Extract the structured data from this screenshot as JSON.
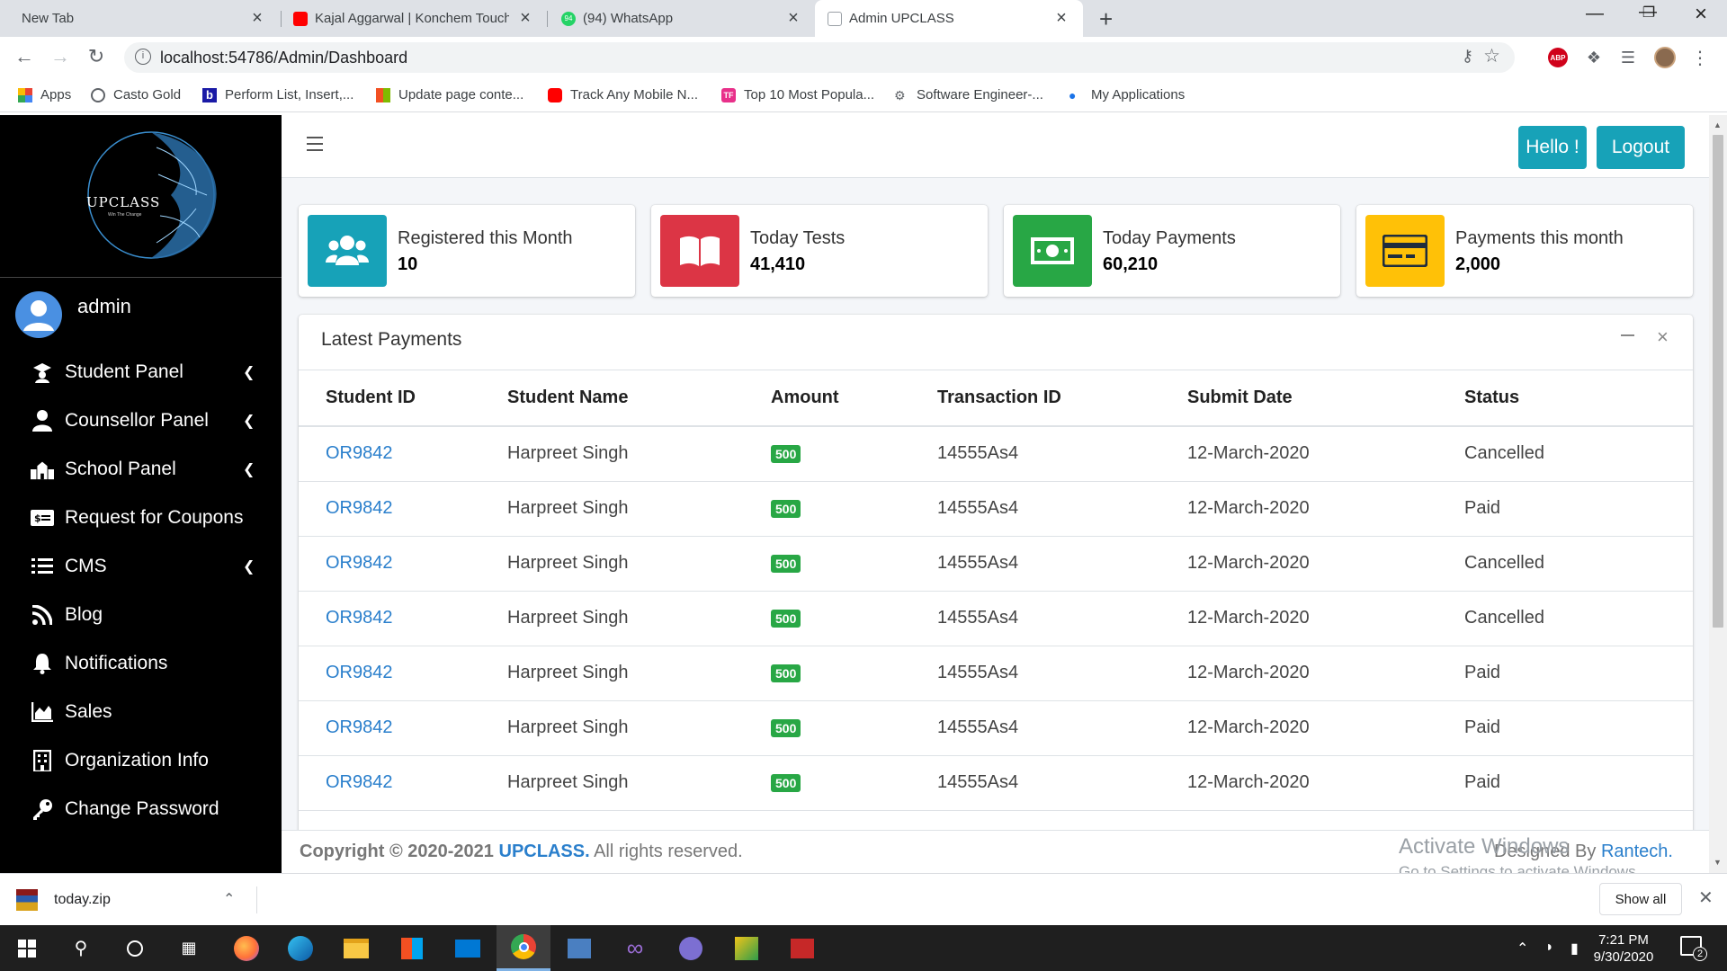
{
  "browser": {
    "tabs": [
      {
        "title": "New Tab",
        "active": false
      },
      {
        "title": "Kajal Aggarwal | Konchem Touch",
        "active": false
      },
      {
        "title": "(94) WhatsApp",
        "active": false
      },
      {
        "title": "Admin UPCLASS",
        "active": true
      }
    ],
    "url": "localhost:54786/Admin/Dashboard",
    "whatsapp_badge": "94",
    "abp_label": "ABP"
  },
  "bookmarks": [
    {
      "label": "Apps",
      "icon": "apps-grid-icon"
    },
    {
      "label": "Casto Gold",
      "icon": "globe-icon"
    },
    {
      "label": "Perform List, Insert,...",
      "icon": "b-logo-icon"
    },
    {
      "label": "Update page conte...",
      "icon": "microsoft-icon"
    },
    {
      "label": "Track Any Mobile N...",
      "icon": "youtube-icon"
    },
    {
      "label": "Top 10 Most Popula...",
      "icon": "tf-icon"
    },
    {
      "label": "Software Engineer-...",
      "icon": "bike-icon"
    },
    {
      "label": "My Applications",
      "icon": "bulb-icon"
    }
  ],
  "sidebar": {
    "logo_text": "UPCLASS",
    "logo_tagline": "Win The Change",
    "user_name": "admin",
    "items": [
      {
        "label": "Student Panel",
        "icon": "graduate-icon",
        "has_arrow": true
      },
      {
        "label": "Counsellor Panel",
        "icon": "user-icon",
        "has_arrow": true
      },
      {
        "label": "School Panel",
        "icon": "school-icon",
        "has_arrow": true
      },
      {
        "label": "Request for Coupons",
        "icon": "coupon-icon",
        "has_arrow": false
      },
      {
        "label": "CMS",
        "icon": "list-icon",
        "has_arrow": true
      },
      {
        "label": "Blog",
        "icon": "rss-icon",
        "has_arrow": false
      },
      {
        "label": "Notifications",
        "icon": "bell-icon",
        "has_arrow": false
      },
      {
        "label": "Sales",
        "icon": "chart-area-icon",
        "has_arrow": false
      },
      {
        "label": "Organization Info",
        "icon": "building-icon",
        "has_arrow": false
      },
      {
        "label": "Change Password",
        "icon": "key-icon",
        "has_arrow": false
      }
    ],
    "arrow_glyph": "❮"
  },
  "header": {
    "hello_label": "Hello !",
    "logout_label": "Logout"
  },
  "stats": [
    {
      "label": "Registered this Month",
      "value": "10",
      "color": "#17a2b8",
      "icon": "users-icon"
    },
    {
      "label": "Today Tests",
      "value": "41,410",
      "color": "#dc3545",
      "icon": "book-icon"
    },
    {
      "label": "Today Payments",
      "value": "60,210",
      "color": "#28a745",
      "icon": "money-icon"
    },
    {
      "label": "Payments this month",
      "value": "2,000",
      "color": "#ffc107",
      "icon": "credit-card-icon"
    }
  ],
  "payments": {
    "title": "Latest Payments",
    "close_glyph": "×",
    "columns": [
      "Student ID",
      "Student Name",
      "Amount",
      "Transaction ID",
      "Submit Date",
      "Status"
    ],
    "rows": [
      [
        "OR9842",
        "Harpreet Singh",
        "500",
        "14555As4",
        "12-March-2020",
        "Cancelled"
      ],
      [
        "OR9842",
        "Harpreet Singh",
        "500",
        "14555As4",
        "12-March-2020",
        "Paid"
      ],
      [
        "OR9842",
        "Harpreet Singh",
        "500",
        "14555As4",
        "12-March-2020",
        "Cancelled"
      ],
      [
        "OR9842",
        "Harpreet Singh",
        "500",
        "14555As4",
        "12-March-2020",
        "Cancelled"
      ],
      [
        "OR9842",
        "Harpreet Singh",
        "500",
        "14555As4",
        "12-March-2020",
        "Paid"
      ],
      [
        "OR9842",
        "Harpreet Singh",
        "500",
        "14555As4",
        "12-March-2020",
        "Paid"
      ],
      [
        "OR9842",
        "Harpreet Singh",
        "500",
        "14555As4",
        "12-March-2020",
        "Paid"
      ]
    ]
  },
  "footer": {
    "copyright_prefix": "Copyright © 2020-2021",
    "brand": "UPCLASS.",
    "rights": "All rights reserved.",
    "designed_by": "Designed By",
    "designer": "Rantech."
  },
  "watermark": {
    "line1": "Activate Windows",
    "line2": "Go to Settings to activate Windows."
  },
  "downloads": {
    "file": "today.zip",
    "show_all": "Show all"
  },
  "taskbar": {
    "time": "7:21 PM",
    "date": "9/30/2020",
    "notification_count": "2"
  }
}
